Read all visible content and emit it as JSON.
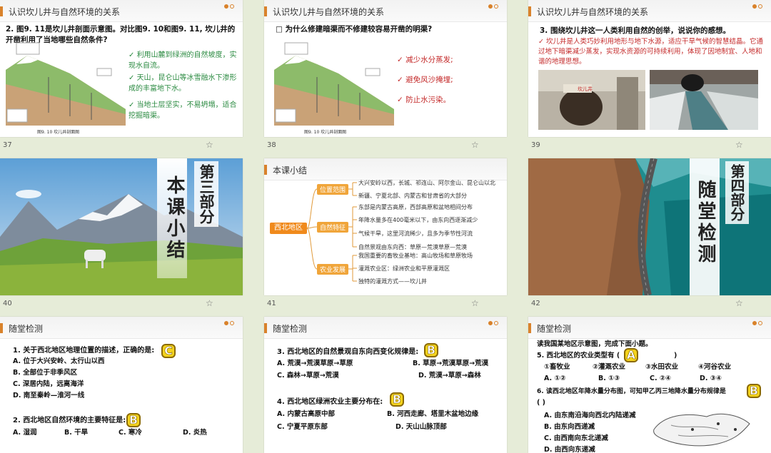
{
  "section_title_kaner": "认识坎儿井与自然环境的关系",
  "section_title_test": "随堂检测",
  "section_title_summary": "本课小结",
  "slide_numbers": [
    "37",
    "38",
    "39",
    "40",
    "41",
    "42"
  ],
  "s37": {
    "question": "2. 图9. 11是坎儿井剖面示意图。对比图9. 10和图9. 11, 坎儿井的开凿利用了当地哪些自然条件?",
    "points": [
      "利用山麓到绿洲的自然坡度，实现水自流。",
      "天山，昆仑山等冰雪融水下渗形成的丰富地下水。",
      "当地土层坚实，不易坍塌，适合挖掘暗渠。"
    ],
    "fig_caption": "图9. 10 坎儿井剖面图"
  },
  "s38": {
    "question": "为什么修建暗渠而不修建较容易开凿的明渠?",
    "answers": [
      "减少水分蒸发;",
      "避免风沙掩埋;",
      "防止水污染。"
    ],
    "fig_caption": "图9. 10 坎儿井剖面图"
  },
  "s39": {
    "question": "3. 围绕坎儿井这一人类利用自然的创举，说说你的感想。",
    "answer": "坎儿井是人类巧妙利用地形与地下水源，适应干旱气候的智慧结晶。它通过地下暗渠减少蒸发，实现水资源的可持续利用，体现了因地制宜、人地和谐的地理思想。"
  },
  "s40": {
    "vertical": "第三部分",
    "title": "本课小结"
  },
  "s41": {
    "center": "西北地区",
    "branches": [
      {
        "tag": "位置范围",
        "lines": [
          "大兴安岭以西，长城、祁连山、阿尔金山、昆仑山以北",
          "新疆、宁夏北部、内蒙古和甘肃省的大部分"
        ]
      },
      {
        "tag": "自然特征",
        "lines": [
          "东部是内蒙古高原，西部高原和盆地相间分布",
          "年降水量多在400毫米以下，由东向西逐渐减少",
          "气候干旱，这里河流稀少，且多为季节性河流",
          "自然景观由东向西：草原—荒漠草原—荒漠"
        ]
      },
      {
        "tag": "农业发展",
        "lines": [
          "我国重要的畜牧业基地：高山牧场和草原牧场",
          "灌溉农业区：绿洲农业和平原灌溉区",
          "独特的灌溉方式——坎儿井"
        ]
      }
    ]
  },
  "s42": {
    "vertical_top": "第四部分",
    "vertical_title": "随堂检测"
  },
  "s43": {
    "q1": "1. 关于西北地区地理位置的描述，正确的是:",
    "q1_answer": "C",
    "q1_options": [
      "A. 位于大兴安岭、太行山以西",
      "B. 全部位于非季风区",
      "C. 深居内陆，远离海洋",
      "D. 南至秦岭—淮河一线"
    ],
    "q2": "2. 西北地区自然环境的主要特征是:",
    "q2_answer": "B",
    "q2_options": [
      "A. 湿润",
      "B. 干旱",
      "C. 寒冷",
      "D. 炎热"
    ]
  },
  "s44": {
    "q3": "3. 西北地区的自然景观自东向西变化规律是:",
    "q3_answer": "B",
    "q3_options": [
      "A. 荒漠→荒漠草原→草原",
      "B. 草原→荒漠草原→荒漠",
      "C. 森林→草原→荒漠",
      "D. 荒漠→草原→森林"
    ],
    "q4": "4. 西北地区绿洲农业主要分布在:",
    "q4_answer": "B",
    "q4_options": [
      "A. 内蒙古高原中部",
      "B. 河西走廊、塔里木盆地边缘",
      "C. 宁夏平原东部",
      "D. 天山山脉顶部"
    ]
  },
  "s45": {
    "intro": "读我国某地区示意图，完成下面小题。",
    "q5": "5. 西北地区的农业类型有 (",
    "q5_close": ")",
    "q5_answer": "A",
    "q5_items": [
      "①畜牧业",
      "②灌溉农业",
      "③水田农业",
      "④河谷农业"
    ],
    "q5_options": [
      "A. ①②",
      "B. ①③",
      "C. ②④",
      "D. ③④"
    ],
    "q6": "6. 读西北地区年降水量分布图，可知甲乙丙三地降水量分布规律是",
    "q6_paren": "(          )",
    "q6_answer": "B",
    "q6_options": [
      "A. 由东南沿海向西北内陆递减",
      "B. 由东向西递减",
      "C. 由西南向东北递减",
      "D. 由西向东递减"
    ]
  },
  "colors": {
    "accent": "#d9822b",
    "green": "#2a8a40",
    "red": "#c42a2a",
    "background": "#e6ecd8"
  }
}
